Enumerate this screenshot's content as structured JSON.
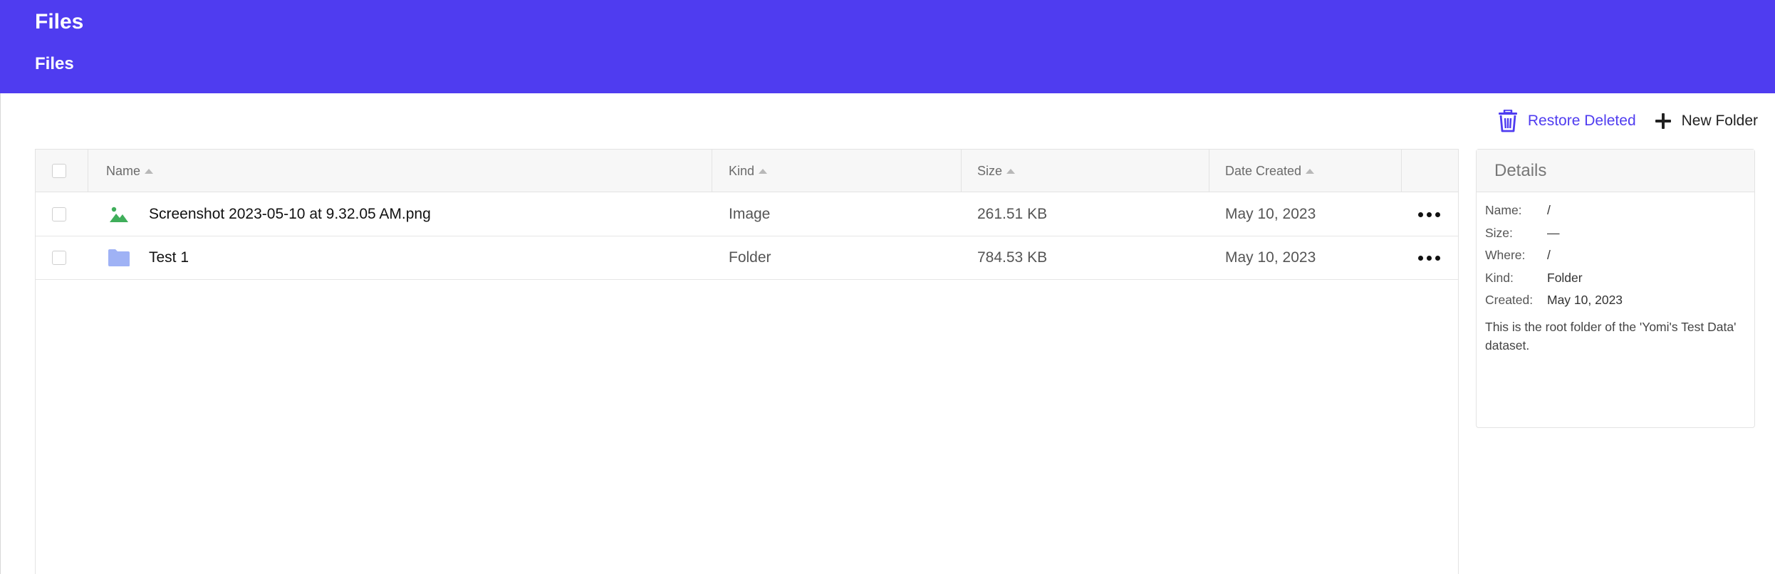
{
  "header": {
    "app_title": "Files",
    "breadcrumb": "Files"
  },
  "toolbar": {
    "restore_label": "Restore Deleted",
    "new_folder_label": "New Folder",
    "accent_color": "#4f3cf0"
  },
  "table": {
    "columns": [
      {
        "label": "Name"
      },
      {
        "label": "Kind"
      },
      {
        "label": "Size"
      },
      {
        "label": "Date Created"
      }
    ],
    "rows": [
      {
        "icon": "image-file-icon",
        "name": "Screenshot 2023-05-10 at 9.32.05 AM.png",
        "kind": "Image",
        "size": "261.51 KB",
        "date": "May 10, 2023"
      },
      {
        "icon": "folder-icon",
        "name": "Test 1",
        "kind": "Folder",
        "size": "784.53 KB",
        "date": "May 10, 2023"
      }
    ]
  },
  "details": {
    "title": "Details",
    "fields": [
      {
        "label": "Name:",
        "value": "/"
      },
      {
        "label": "Size:",
        "value": "—"
      },
      {
        "label": "Where:",
        "value": "/"
      },
      {
        "label": "Kind:",
        "value": "Folder"
      },
      {
        "label": "Created:",
        "value": "May 10, 2023"
      }
    ],
    "description": "This is the root folder of the 'Yomi's Test Data' dataset."
  },
  "colors": {
    "header_bg": "#4f3cf0",
    "image_icon": "#3fae5a",
    "folder_icon": "#9fb2f5"
  }
}
